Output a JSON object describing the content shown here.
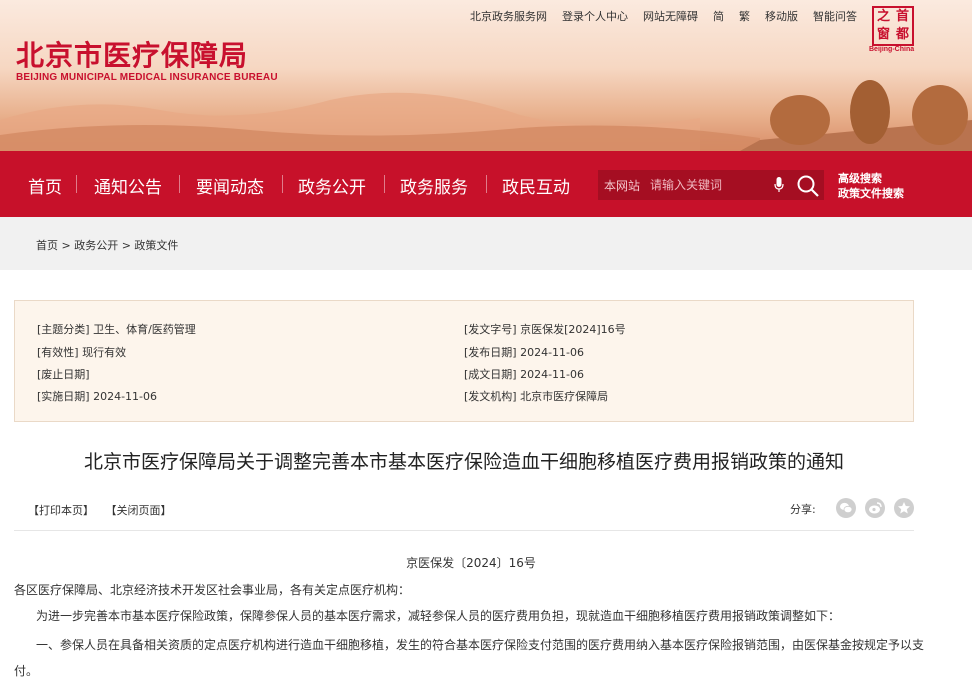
{
  "header": {
    "title_cn": "北京市医疗保障局",
    "title_en": "BEIJING MUNICIPAL MEDICAL INSURANCE BUREAU",
    "top_links": [
      "北京政务服务网",
      "登录个人中心",
      "网站无障碍",
      "简",
      "繁",
      "移动版",
      "智能问答"
    ],
    "seal_chars": [
      "之",
      "首",
      "窗",
      "都"
    ],
    "seal_sub": "Beijing-China"
  },
  "nav": {
    "items": [
      "首页",
      "通知公告",
      "要闻动态",
      "政务公开",
      "政务服务",
      "政民互动"
    ],
    "search": {
      "scope": "本网站",
      "placeholder": "请输入关键词"
    },
    "advanced_search": "高级搜索",
    "policy_search": "政策文件搜索"
  },
  "breadcrumb": "首页 > 政务公开 > 政策文件",
  "meta": {
    "topic_label": "[主题分类]",
    "topic": "卫生、体育/医药管理",
    "validity_label": "[有效性]",
    "validity": "现行有效",
    "repeal_label": "[废止日期]",
    "repeal": "",
    "effective_label": "[实施日期]",
    "effective": "2024-11-06",
    "docno_label": "[发文字号]",
    "docno": "京医保发[2024]16号",
    "publish_label": "[发布日期]",
    "publish": "2024-11-06",
    "created_label": "[成文日期]",
    "created": "2024-11-06",
    "issuer_label": "[发文机构]",
    "issuer": "北京市医疗保障局"
  },
  "article": {
    "title": "北京市医疗保障局关于调整完善本市基本医疗保险造血干细胞移植医疗费用报销政策的通知",
    "print_label": "【打印本页】",
    "close_label": "【关闭页面】",
    "share_label": "分享:",
    "doc_number": "京医保发〔2024〕16号",
    "salutation": "各区医疗保障局、北京经济技术开发区社会事业局，各有关定点医疗机构：",
    "intro": "为进一步完善本市基本医疗保险政策，保障参保人员的基本医疗需求，减轻参保人员的医疗费用负担，现就造血干细胞移植医疗费用报销政策调整如下：",
    "para1": "一、参保人员在具备相关资质的定点医疗机构进行造血干细胞移植，发生的符合基本医疗保险支付范围的医疗费用纳入基本医疗保险报销范围，由医保基金按规定予以支付。"
  }
}
